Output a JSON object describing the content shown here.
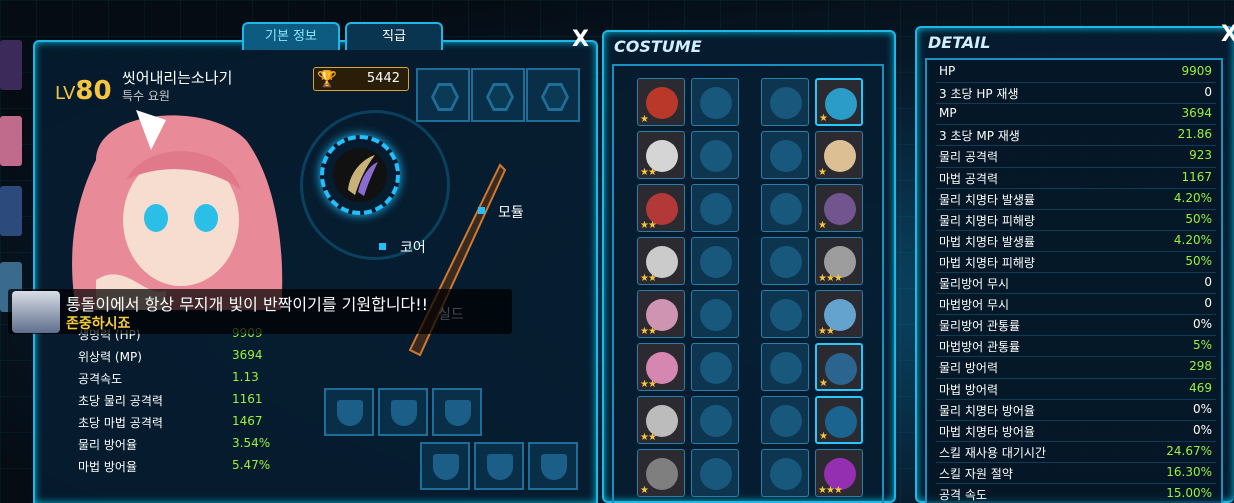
{
  "left_panel": {
    "tabs": [
      {
        "label": "기본 정보"
      },
      {
        "label": "직급"
      }
    ],
    "close": "X",
    "level_prefix": "LV",
    "level": "80",
    "character_name": "씻어내리는소나기",
    "class_name": "특수 요원",
    "gold": "5442",
    "labels": {
      "core": "코어",
      "module": "모듈",
      "seal": "실드"
    },
    "chat": {
      "message": "통돌이에서 항상 무지개 빛이 반짝이기를 기원합니다!!",
      "sender": "존중하시죠"
    },
    "stats": [
      {
        "label": "생명력 (HP)",
        "value": "9909"
      },
      {
        "label": "위상력 (MP)",
        "value": "3694"
      },
      {
        "label": "공격속도",
        "value": "1.13"
      },
      {
        "label": "초당 물리 공격력",
        "value": "1161"
      },
      {
        "label": "초당 마법 공격력",
        "value": "1467"
      },
      {
        "label": "물리 방어율",
        "value": "3.54%"
      },
      {
        "label": "마법 방어율",
        "value": "5.47%"
      }
    ]
  },
  "costume": {
    "title": "COSTUME",
    "left_column": [
      {
        "stars": "★"
      },
      {
        "stars": "★★"
      },
      {
        "stars": "★★"
      },
      {
        "stars": "★★"
      },
      {
        "stars": "★★"
      },
      {
        "stars": "★★"
      },
      {
        "stars": "★★"
      },
      {
        "stars": "★"
      }
    ],
    "right_column": [
      {
        "stars": "★"
      },
      {
        "stars": "★"
      },
      {
        "stars": "★"
      },
      {
        "stars": "★★★"
      },
      {
        "stars": "★★"
      },
      {
        "stars": "★"
      },
      {
        "stars": "★"
      },
      {
        "stars": "★★★"
      }
    ]
  },
  "detail": {
    "title": "DETAIL",
    "close": "X",
    "rows": [
      {
        "label": "HP",
        "value": "9909"
      },
      {
        "label": "3 초당 HP 재생",
        "value": "0"
      },
      {
        "label": "MP",
        "value": "3694"
      },
      {
        "label": "3 초당 MP 재생",
        "value": "21.86"
      },
      {
        "label": "물리 공격력",
        "value": "923"
      },
      {
        "label": "마법 공격력",
        "value": "1167"
      },
      {
        "label": "물리 치명타 발생률",
        "value": "4.20%"
      },
      {
        "label": "물리 치명타 피해량",
        "value": "50%"
      },
      {
        "label": "마법 치명타 발생률",
        "value": "4.20%"
      },
      {
        "label": "마법 치명타 피해량",
        "value": "50%"
      },
      {
        "label": "물리방어 무시",
        "value": "0"
      },
      {
        "label": "마법방어 무시",
        "value": "0"
      },
      {
        "label": "물리방어 관통률",
        "value": "0%"
      },
      {
        "label": "마법방어 관통률",
        "value": "5%"
      },
      {
        "label": "물리 방어력",
        "value": "298"
      },
      {
        "label": "마법 방어력",
        "value": "469"
      },
      {
        "label": "물리 치명타 방어율",
        "value": "0%"
      },
      {
        "label": "마법 치명타 방어율",
        "value": "0%"
      },
      {
        "label": "스킬 재사용 대기시간",
        "value": "24.67%"
      },
      {
        "label": "스킬 자원 절약",
        "value": "16.30%"
      },
      {
        "label": "공격 속도",
        "value": "15.00%"
      }
    ]
  }
}
